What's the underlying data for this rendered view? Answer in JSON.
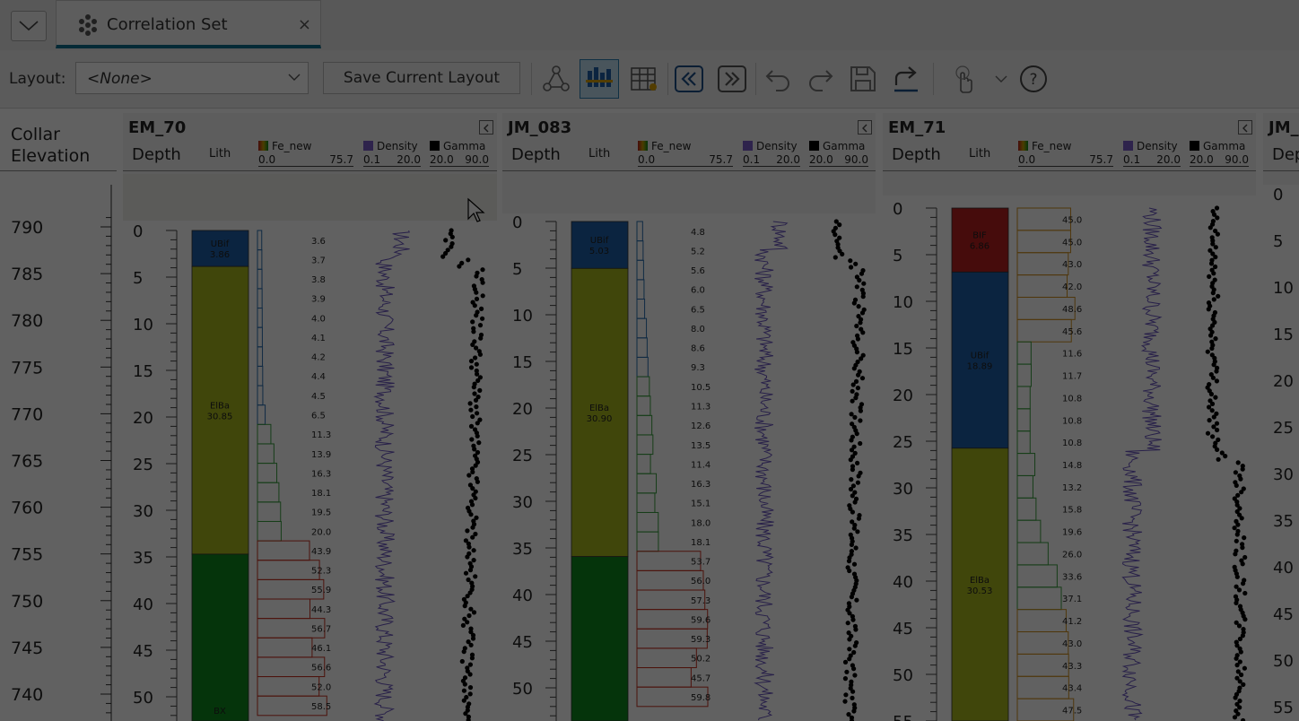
{
  "tab": {
    "title": "Correlation Set",
    "icon": "scene-icon",
    "close": "×"
  },
  "toolbar": {
    "layout_label": "Layout:",
    "layout_value": "<None>",
    "save_label": "Save Current Layout",
    "buttons": [
      "connect-icon",
      "correlation-view-icon",
      "table-icon",
      "previous-icon",
      "next-icon",
      "undo-icon",
      "redo-icon",
      "save-icon",
      "export-icon",
      "pan-icon",
      "dropdown-icon",
      "help-icon"
    ],
    "help_text": "?"
  },
  "collar": {
    "title": "Collar Elevation",
    "ticks": [
      "790",
      "785",
      "780",
      "775",
      "770",
      "765",
      "760",
      "755",
      "750",
      "745",
      "740"
    ]
  },
  "legend": {
    "lith": "Lith",
    "depth": "Depth",
    "fe_label": "Fe_new",
    "fe_min": "0.0",
    "fe_max": "75.7",
    "density_label": "Density",
    "density_min": "0.1",
    "density_max": "20.0",
    "gamma_label": "Gamma",
    "gamma_min": "20.0",
    "gamma_max": "90.0",
    "colors": {
      "fe": "#c8a000",
      "density": "#7a5cc8",
      "gamma": "#000000"
    }
  },
  "holes": [
    {
      "name": "EM_70",
      "depth_ticks": [
        "0",
        "5",
        "10",
        "15",
        "20",
        "25",
        "30",
        "35",
        "40",
        "45",
        "50"
      ],
      "lith": [
        {
          "code": "UBif",
          "value": "3.86",
          "color": "#1f5fa8"
        },
        {
          "code": "ElBa",
          "value": "30.85",
          "color": "#a8b81e"
        },
        {
          "code": "BX",
          "value": "",
          "color": "#0e8a1e"
        }
      ],
      "fe_values": [
        "3.6",
        "3.7",
        "3.8",
        "3.9",
        "4.0",
        "4.1",
        "4.2",
        "4.4",
        "4.5",
        "6.5",
        "11.3",
        "13.9",
        "16.3",
        "18.1",
        "19.5",
        "20.0",
        "43.9",
        "52.3",
        "55.9",
        "44.3",
        "56.7",
        "46.1",
        "56.6",
        "52.0",
        "58.5"
      ]
    },
    {
      "name": "JM_083",
      "depth_ticks": [
        "0",
        "5",
        "10",
        "15",
        "20",
        "25",
        "30",
        "35",
        "40",
        "45",
        "50"
      ],
      "lith": [
        {
          "code": "UBif",
          "value": "5.03",
          "color": "#1f5fa8"
        },
        {
          "code": "ElBa",
          "value": "30.90",
          "color": "#a8b81e"
        },
        {
          "code": "",
          "value": "",
          "color": "#0e8a1e"
        }
      ],
      "fe_values": [
        "4.8",
        "5.2",
        "5.6",
        "6.0",
        "6.5",
        "8.0",
        "8.6",
        "9.3",
        "10.5",
        "11.3",
        "12.6",
        "13.5",
        "11.4",
        "16.3",
        "15.1",
        "18.0",
        "18.1",
        "53.7",
        "56.0",
        "57.3",
        "59.6",
        "59.3",
        "50.2",
        "45.7",
        "59.8"
      ]
    },
    {
      "name": "EM_71",
      "depth_ticks": [
        "0",
        "5",
        "10",
        "15",
        "20",
        "25",
        "30",
        "35",
        "40",
        "45",
        "50",
        "55"
      ],
      "lith": [
        {
          "code": "BIF",
          "value": "6.86",
          "color": "#b82020"
        },
        {
          "code": "UBif",
          "value": "18.89",
          "color": "#1f5fa8"
        },
        {
          "code": "ElBa",
          "value": "30.53",
          "color": "#a8b81e"
        }
      ],
      "fe_values": [
        "45.0",
        "45.0",
        "43.0",
        "42.0",
        "48.6",
        "45.6",
        "11.6",
        "11.7",
        "10.8",
        "10.8",
        "10.8",
        "14.8",
        "13.2",
        "15.8",
        "19.6",
        "26.0",
        "33.6",
        "37.1",
        "41.2",
        "43.0",
        "43.3",
        "43.4",
        "47.5"
      ]
    },
    {
      "name": "JM_",
      "depth_label": "Dep",
      "depth_ticks": [
        "0",
        "5",
        "10",
        "15",
        "20",
        "25",
        "30",
        "35",
        "40",
        "45",
        "50",
        "55"
      ]
    }
  ]
}
